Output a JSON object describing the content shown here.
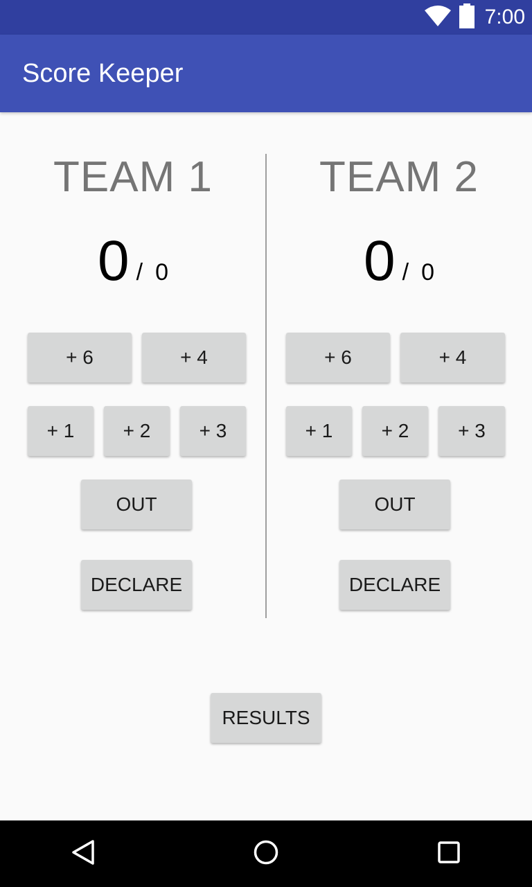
{
  "status_bar": {
    "time": "7:00",
    "icons": [
      "wifi-icon",
      "battery-icon"
    ]
  },
  "app_bar": {
    "title": "Score Keeper"
  },
  "teams": [
    {
      "name": "TEAM 1",
      "runs": "0",
      "separator": "/",
      "wickets": "0",
      "buttons": {
        "plus6": "+ 6",
        "plus4": "+ 4",
        "plus1": "+ 1",
        "plus2": "+ 2",
        "plus3": "+ 3",
        "out": "OUT",
        "declare": "DECLARE"
      }
    },
    {
      "name": "TEAM 2",
      "runs": "0",
      "separator": "/",
      "wickets": "0",
      "buttons": {
        "plus6": "+ 6",
        "plus4": "+ 4",
        "plus1": "+ 1",
        "plus2": "+ 2",
        "plus3": "+ 3",
        "out": "OUT",
        "declare": "DECLARE"
      }
    }
  ],
  "results_label": "RESULTS",
  "nav_bar": {
    "icons": [
      "back-icon",
      "home-icon",
      "recents-icon"
    ]
  },
  "colors": {
    "status_bar": "#303f9f",
    "app_bar": "#3f51b5",
    "button": "#d6d7d7",
    "team_name": "#757575"
  }
}
